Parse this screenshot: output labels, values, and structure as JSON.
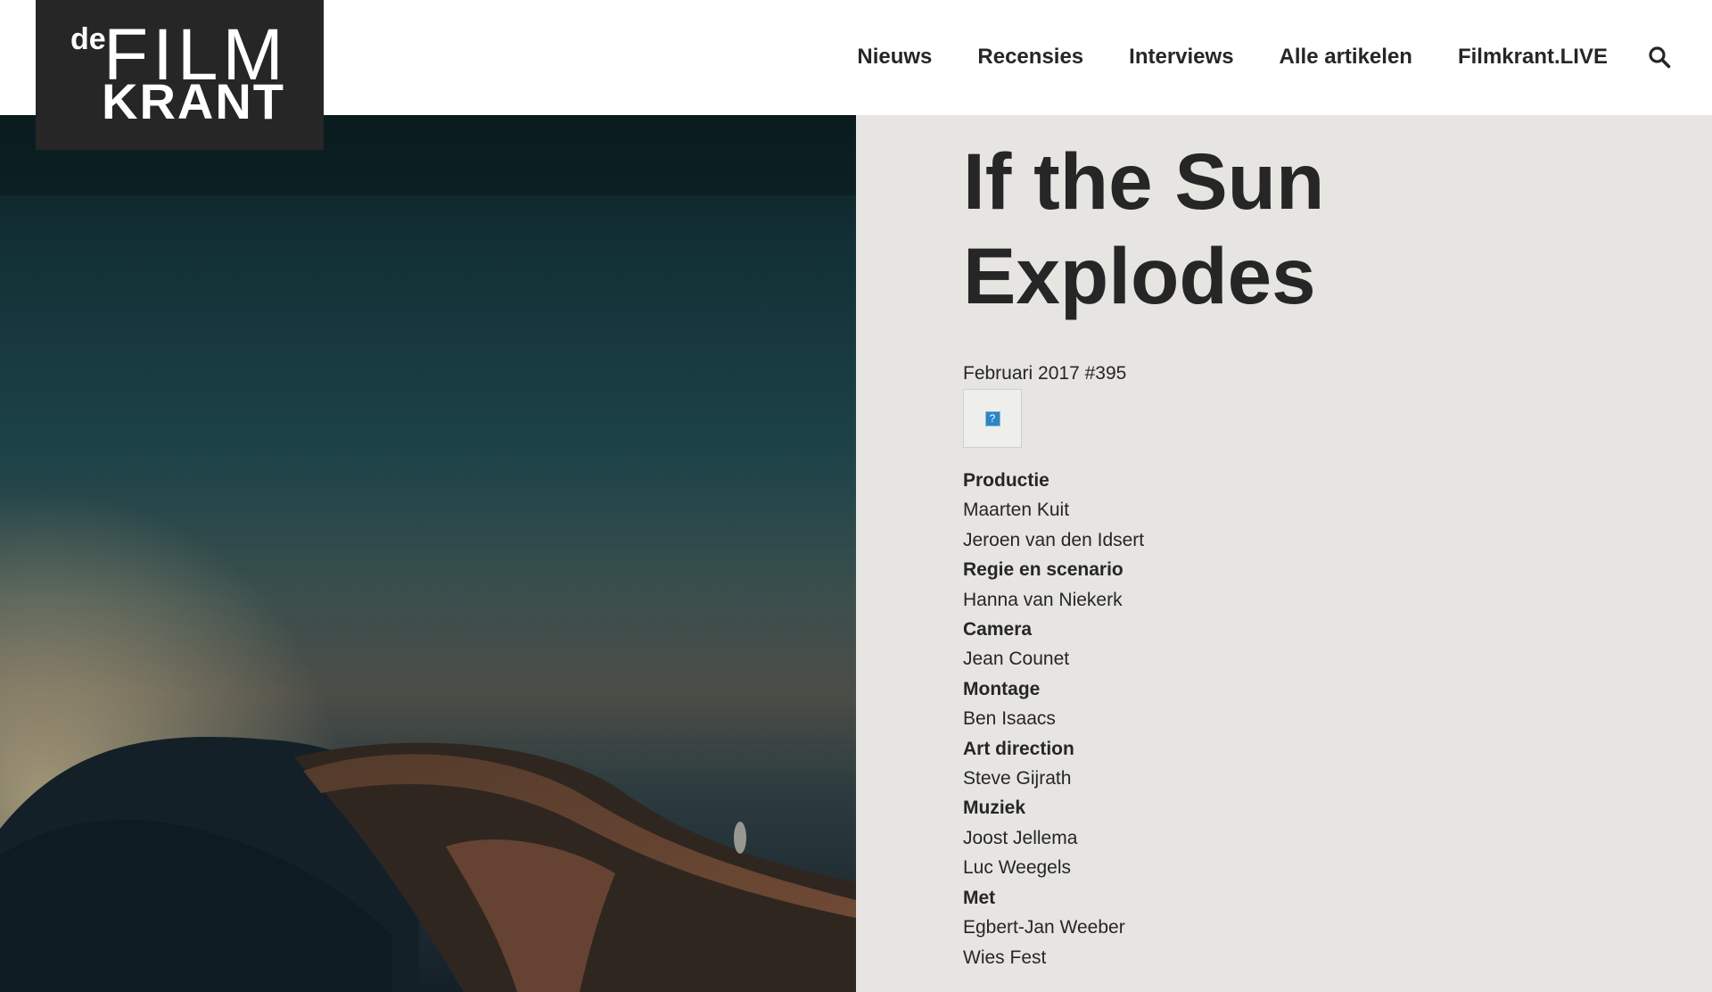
{
  "site": {
    "logo": {
      "de": "de",
      "film": "FILM",
      "krant": "KRANT"
    },
    "nav": [
      {
        "label": "Nieuws"
      },
      {
        "label": "Recensies"
      },
      {
        "label": "Interviews"
      },
      {
        "label": "Alle artikelen"
      },
      {
        "label": "Filmkrant.LIVE"
      }
    ],
    "search_icon": "search-icon"
  },
  "colors": {
    "header_bg": "#ffffff",
    "logo_bg": "#262626",
    "page_bg": "#e6e5e1",
    "text": "#262626"
  },
  "article": {
    "title_line1": "If the Sun",
    "title_line2": "Explodes",
    "issue": "Februari 2017 #395",
    "image_placeholder_icon": "broken-image-icon",
    "image_placeholder_glyph": "?",
    "credits": [
      {
        "type": "label",
        "text": "Productie"
      },
      {
        "type": "value",
        "text": "Maarten Kuit"
      },
      {
        "type": "value",
        "text": "Jeroen van den Idsert"
      },
      {
        "type": "label",
        "text": "Regie en scenario"
      },
      {
        "type": "value",
        "text": "Hanna van Niekerk"
      },
      {
        "type": "label",
        "text": "Camera"
      },
      {
        "type": "value",
        "text": "Jean Counet"
      },
      {
        "type": "label",
        "text": "Montage"
      },
      {
        "type": "value",
        "text": "Ben Isaacs"
      },
      {
        "type": "label",
        "text": "Art direction"
      },
      {
        "type": "value",
        "text": "Steve Gijrath"
      },
      {
        "type": "label",
        "text": "Muziek"
      },
      {
        "type": "value",
        "text": "Joost Jellema"
      },
      {
        "type": "value",
        "text": "Luc Weegels"
      },
      {
        "type": "label",
        "text": "Met"
      },
      {
        "type": "value",
        "text": "Egbert-Jan Weeber"
      },
      {
        "type": "value",
        "text": "Wies Fest"
      }
    ]
  }
}
